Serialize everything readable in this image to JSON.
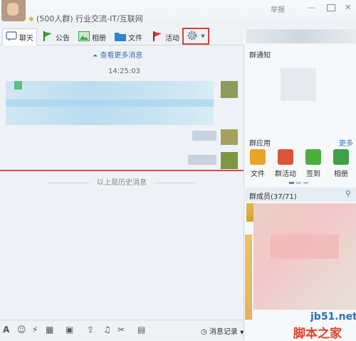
{
  "header": {
    "group_line": "(500人群) 行业交流-IT/互联网",
    "report": "举报",
    "minimize": "—",
    "close": "✕"
  },
  "tabs": [
    {
      "label": "聊天",
      "icon": "chat-icon",
      "color": "#4a90d9"
    },
    {
      "label": "公告",
      "icon": "notice-flag-icon",
      "color": "#3fa535"
    },
    {
      "label": "相册",
      "icon": "album-icon",
      "color": "#3aa04a"
    },
    {
      "label": "文件",
      "icon": "folder-icon",
      "color": "#2a84d2"
    },
    {
      "label": "活动",
      "icon": "activity-flag-icon",
      "color": "#d93a3a"
    }
  ],
  "chat": {
    "more_messages": "查看更多消息",
    "time": "14:25:03",
    "history_divider": "以上是历史消息"
  },
  "toolbar": {
    "records_label": "消息记录"
  },
  "side": {
    "notice_title": "群通知",
    "apps_title": "群应用",
    "more": "更多",
    "apps": [
      {
        "label": "文件",
        "icon": "file-app-icon",
        "color": "#e9a42a"
      },
      {
        "label": "群活动",
        "icon": "group-activity-app-icon",
        "color": "#d9553a"
      },
      {
        "label": "签到",
        "icon": "checkin-app-icon",
        "color": "#4caf3c"
      },
      {
        "label": "相册",
        "icon": "album-app-icon",
        "color": "#3f9f45"
      }
    ],
    "members_title": "群成员(37/71)"
  },
  "watermark": {
    "site": "jb51.net",
    "name": "脚本之家"
  }
}
